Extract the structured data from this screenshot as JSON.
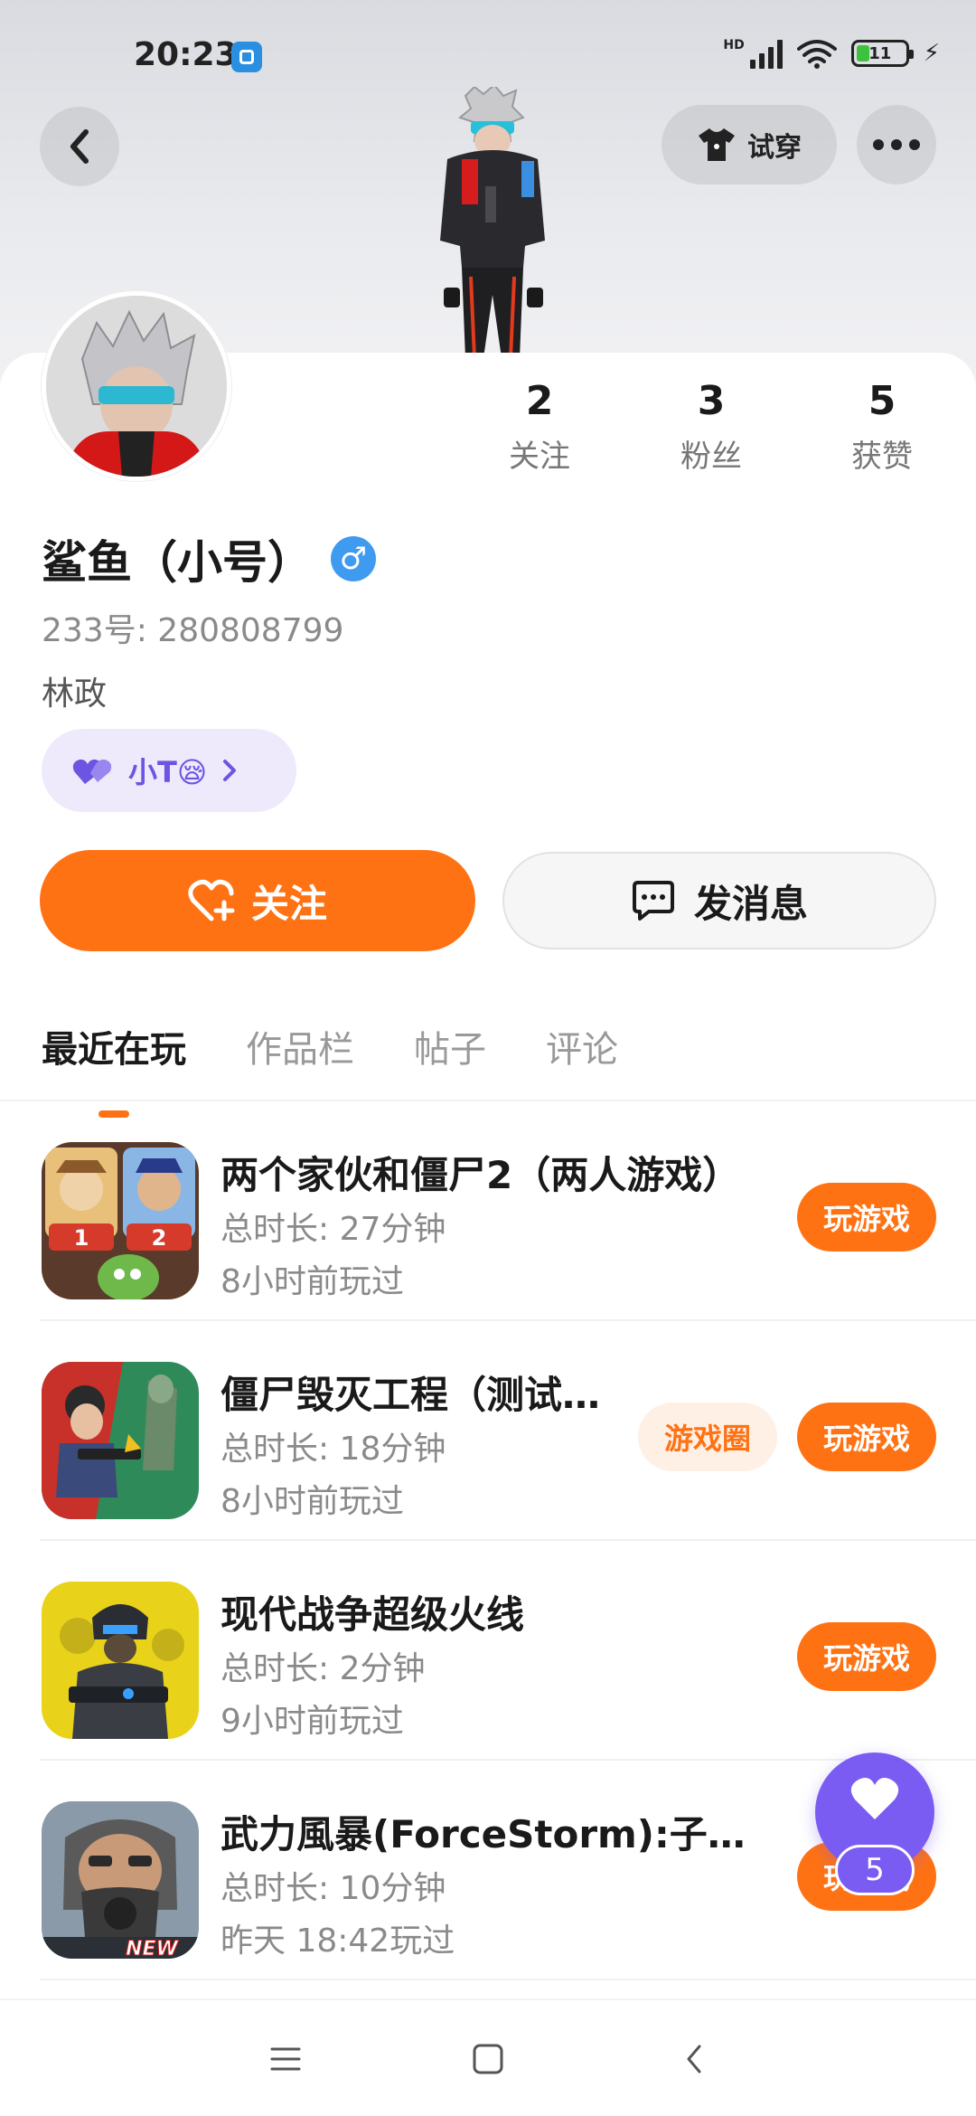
{
  "status_bar": {
    "time": "20:23",
    "network_label": "HD",
    "battery_level": "11",
    "icons": [
      "app-notification-icon",
      "signal-icon",
      "wifi-icon",
      "battery-icon",
      "charging-icon"
    ]
  },
  "top_actions": {
    "back_icon": "chevron-left-icon",
    "try_on_label": "试穿",
    "try_on_icon": "tshirt-icon",
    "more_icon": "more-dots-icon"
  },
  "profile": {
    "username": "鲨鱼（小号）",
    "gender": "male",
    "gender_symbol": "♂",
    "uid": "233号: 280808799",
    "bio": "林政",
    "tag": "小T😪",
    "stats": [
      {
        "value": "2",
        "label": "关注"
      },
      {
        "value": "3",
        "label": "粉丝"
      },
      {
        "value": "5",
        "label": "获赞"
      }
    ]
  },
  "actions": {
    "follow_label": "关注",
    "message_label": "发消息"
  },
  "tabs": [
    {
      "label": "最近在玩",
      "active": true
    },
    {
      "label": "作品栏",
      "active": false
    },
    {
      "label": "帖子",
      "active": false
    },
    {
      "label": "评论",
      "active": false
    }
  ],
  "games": [
    {
      "title": "两个家伙和僵尸2（两人游戏）",
      "duration": "总时长: 27分钟",
      "last_played": "8小时前玩过",
      "play_label": "玩游戏",
      "circle_label": ""
    },
    {
      "title": "僵尸毁灭工程（测试…",
      "duration": "总时长: 18分钟",
      "last_played": "8小时前玩过",
      "play_label": "玩游戏",
      "circle_label": "游戏圈"
    },
    {
      "title": "现代战争超级火线",
      "duration": "总时长: 2分钟",
      "last_played": "9小时前玩过",
      "play_label": "玩游戏",
      "circle_label": ""
    },
    {
      "title": "武力風暴(ForceStorm):子…",
      "duration": "总时长: 10分钟",
      "last_played": "昨天 18:42玩过",
      "play_label": "玩游戏",
      "circle_label": ""
    }
  ],
  "game_icon_badges": [
    "1",
    "2",
    "NEW"
  ],
  "fab": {
    "icon": "heart-icon",
    "count": "5"
  },
  "nav": {
    "icons": [
      "menu-icon",
      "home-square-icon",
      "back-triangle-icon"
    ]
  },
  "colors": {
    "accent": "#ff7213",
    "purple": "#7a5cf2",
    "gender_blue": "#3e9bf0",
    "circle_bg": "#fff0e6"
  }
}
